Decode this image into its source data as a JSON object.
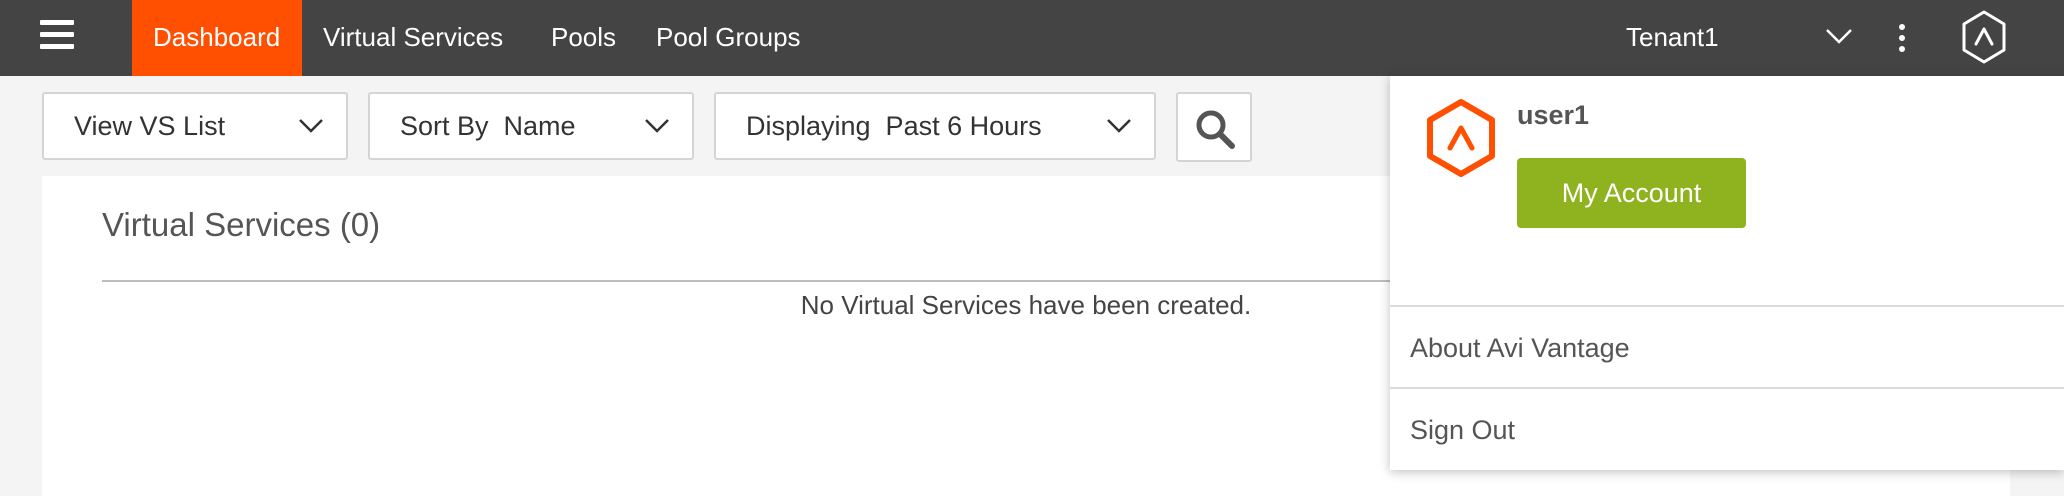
{
  "nav": {
    "tabs": [
      {
        "label": "Dashboard",
        "active": true
      },
      {
        "label": "Virtual Services",
        "active": false
      },
      {
        "label": "Pools",
        "active": false
      },
      {
        "label": "Pool Groups",
        "active": false
      }
    ],
    "tenant": "Tenant1",
    "accent_color": "#ff4f00"
  },
  "toolbar": {
    "view_select": "View VS List",
    "sort_select": "Sort By  Name",
    "time_select": "Displaying  Past 6 Hours",
    "search_icon": "search-icon"
  },
  "main": {
    "title": "Virtual Services (0)",
    "empty_message": "No Virtual Services have been created."
  },
  "user_menu": {
    "username": "user1",
    "my_account_label": "My Account",
    "my_account_color": "#8fb21f",
    "items": [
      "About Avi Vantage",
      "Sign Out"
    ]
  }
}
